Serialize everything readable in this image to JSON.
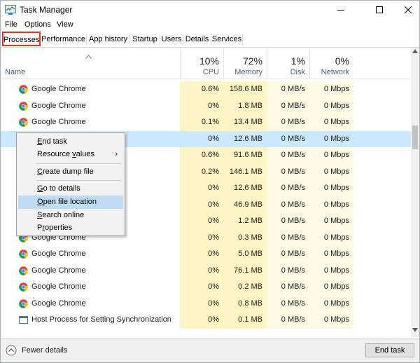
{
  "window": {
    "title": "Task Manager"
  },
  "menu": [
    "File",
    "Options",
    "View"
  ],
  "tabs": [
    "Processes",
    "Performance",
    "App history",
    "Startup",
    "Users",
    "Details",
    "Services"
  ],
  "active_tab": "Processes",
  "columns": {
    "name": "Name",
    "cpu": {
      "pct": "10%",
      "label": "CPU"
    },
    "memory": {
      "pct": "72%",
      "label": "Memory"
    },
    "disk": {
      "pct": "1%",
      "label": "Disk"
    },
    "network": {
      "pct": "0%",
      "label": "Network"
    }
  },
  "rows": [
    {
      "name": "Google Chrome",
      "cpu": "0.6%",
      "memory": "158.6 MB",
      "disk": "0 MB/s",
      "network": "0 Mbps",
      "icon": "chrome-icon"
    },
    {
      "name": "Google Chrome",
      "cpu": "0%",
      "memory": "1.8 MB",
      "disk": "0 MB/s",
      "network": "0 Mbps",
      "icon": "chrome-icon"
    },
    {
      "name": "Google Chrome",
      "cpu": "0.1%",
      "memory": "13.4 MB",
      "disk": "0 MB/s",
      "network": "0 Mbps",
      "icon": "chrome-icon"
    },
    {
      "name": "",
      "cpu": "0%",
      "memory": "12.6 MB",
      "disk": "0 MB/s",
      "network": "0 Mbps",
      "icon": "",
      "selected": true
    },
    {
      "name": "",
      "cpu": "0.6%",
      "memory": "91.6 MB",
      "disk": "0 MB/s",
      "network": "0 Mbps",
      "icon": ""
    },
    {
      "name": "",
      "cpu": "0.2%",
      "memory": "146.1 MB",
      "disk": "0 MB/s",
      "network": "0 Mbps",
      "icon": ""
    },
    {
      "name": "",
      "cpu": "0%",
      "memory": "12.6 MB",
      "disk": "0 MB/s",
      "network": "0 Mbps",
      "icon": ""
    },
    {
      "name": "",
      "cpu": "0%",
      "memory": "46.9 MB",
      "disk": "0 MB/s",
      "network": "0 Mbps",
      "icon": ""
    },
    {
      "name": "",
      "cpu": "0%",
      "memory": "1.2 MB",
      "disk": "0 MB/s",
      "network": "0 Mbps",
      "icon": ""
    },
    {
      "name": "Google Chrome",
      "cpu": "0%",
      "memory": "0.3 MB",
      "disk": "0 MB/s",
      "network": "0 Mbps",
      "icon": "chrome-icon"
    },
    {
      "name": "Google Chrome",
      "cpu": "0%",
      "memory": "5.0 MB",
      "disk": "0 MB/s",
      "network": "0 Mbps",
      "icon": "chrome-icon"
    },
    {
      "name": "Google Chrome",
      "cpu": "0%",
      "memory": "76.1 MB",
      "disk": "0 MB/s",
      "network": "0 Mbps",
      "icon": "chrome-icon"
    },
    {
      "name": "Google Chrome",
      "cpu": "0%",
      "memory": "0.2 MB",
      "disk": "0 MB/s",
      "network": "0 Mbps",
      "icon": "chrome-icon"
    },
    {
      "name": "Google Chrome",
      "cpu": "0%",
      "memory": "0.8 MB",
      "disk": "0 MB/s",
      "network": "0 Mbps",
      "icon": "chrome-icon"
    },
    {
      "name": "Host Process for Setting Synchronization",
      "cpu": "0%",
      "memory": "0.1 MB",
      "disk": "0 MB/s",
      "network": "0 Mbps",
      "icon": "host-process-icon"
    }
  ],
  "context_menu": [
    {
      "label": "End task",
      "mnemonic": "E",
      "rest": "nd task"
    },
    {
      "label": "Resource values",
      "mnemonic": "v",
      "pre": "Resource ",
      "rest": "alues",
      "submenu": true
    },
    {
      "label": "Create dump file",
      "mnemonic": "C",
      "rest": "reate dump file"
    },
    {
      "label": "Go to details",
      "mnemonic": "G",
      "rest": "o to details"
    },
    {
      "label": "Open file location",
      "mnemonic": "O",
      "rest": "pen file location",
      "highlighted": true
    },
    {
      "label": "Search online",
      "mnemonic": "S",
      "rest": "earch online"
    },
    {
      "label": "Properties",
      "mnemonic": "r",
      "pre": "P",
      "rest": "operties"
    }
  ],
  "footer": {
    "fewer_details": "Fewer details",
    "end_task": "End task"
  },
  "colors": {
    "cpu_mem_fill": "#fff4c4",
    "disk_net_fill": "#fffae3",
    "selection": "#cce8ff",
    "active_tab_border": "#e0322e",
    "menu_highlight": "#bfdcf5"
  }
}
